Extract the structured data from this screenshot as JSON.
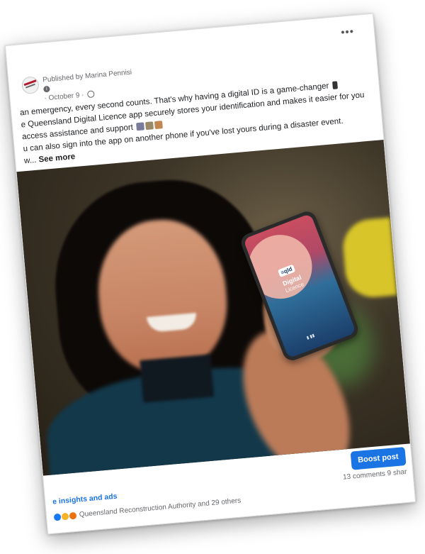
{
  "post": {
    "published_by": "Published by Marina Pennisi",
    "date": "· October 9 ·",
    "lines": [
      "an emergency, every second counts. That's why having a digital ID is a game-changer",
      "e Queensland Digital Licence app securely stores your identification and makes it easier for you",
      "access assistance and support",
      "u can also sign into the app on another phone if you've lost yours during a disaster event.",
      "w..."
    ],
    "see_more": "See more"
  },
  "phone": {
    "logo": "≡qld",
    "title": "Digital",
    "subtitle": "Licence"
  },
  "actions": {
    "boost": "Boost post",
    "insights": "e insights and ads",
    "comments": "13 comments  9 shar",
    "reactions_text": "Queensland Reconstruction Authority and 29 others"
  },
  "icons": {
    "more": "more-horizontal-icon",
    "globe": "globe-icon",
    "info": "info-icon"
  },
  "colors": {
    "accent": "#1b74e4",
    "meta": "#65676b"
  }
}
